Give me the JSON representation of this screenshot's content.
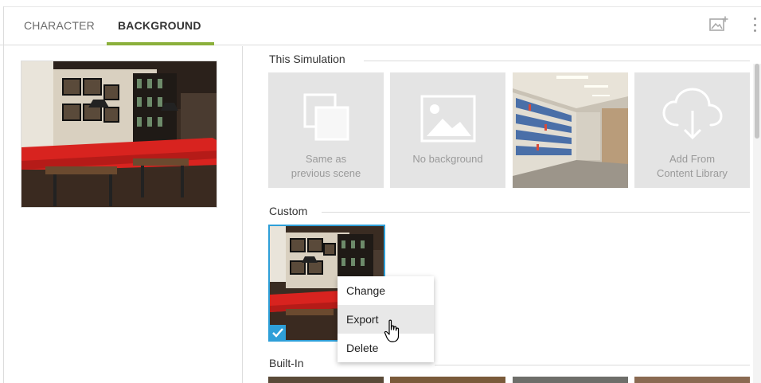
{
  "tabs": {
    "character": "CHARACTER",
    "background": "BACKGROUND",
    "active": "background"
  },
  "toolbar": {
    "add_image_icon": "add-image-icon",
    "more_icon": "more-vertical-icon"
  },
  "sections": {
    "this_simulation": {
      "title": "This Simulation",
      "tiles": [
        {
          "label_line1": "Same as",
          "label_line2": "previous scene",
          "icon": "copy-icon"
        },
        {
          "label_line1": "No background",
          "label_line2": "",
          "icon": "image-icon"
        },
        {
          "label_line1": "",
          "label_line2": "",
          "icon": "library-photo"
        },
        {
          "label_line1": "Add From",
          "label_line2": "Content Library",
          "icon": "cloud-download-icon"
        }
      ]
    },
    "custom": {
      "title": "Custom",
      "selected": true
    },
    "built_in": {
      "title": "Built-In"
    }
  },
  "context_menu": {
    "items": [
      "Change",
      "Export",
      "Delete"
    ],
    "hovered": "Export"
  },
  "colors": {
    "accent_green": "#8bb03b",
    "selection_blue": "#2e9fd8",
    "tile_gray": "#e4e4e4"
  }
}
